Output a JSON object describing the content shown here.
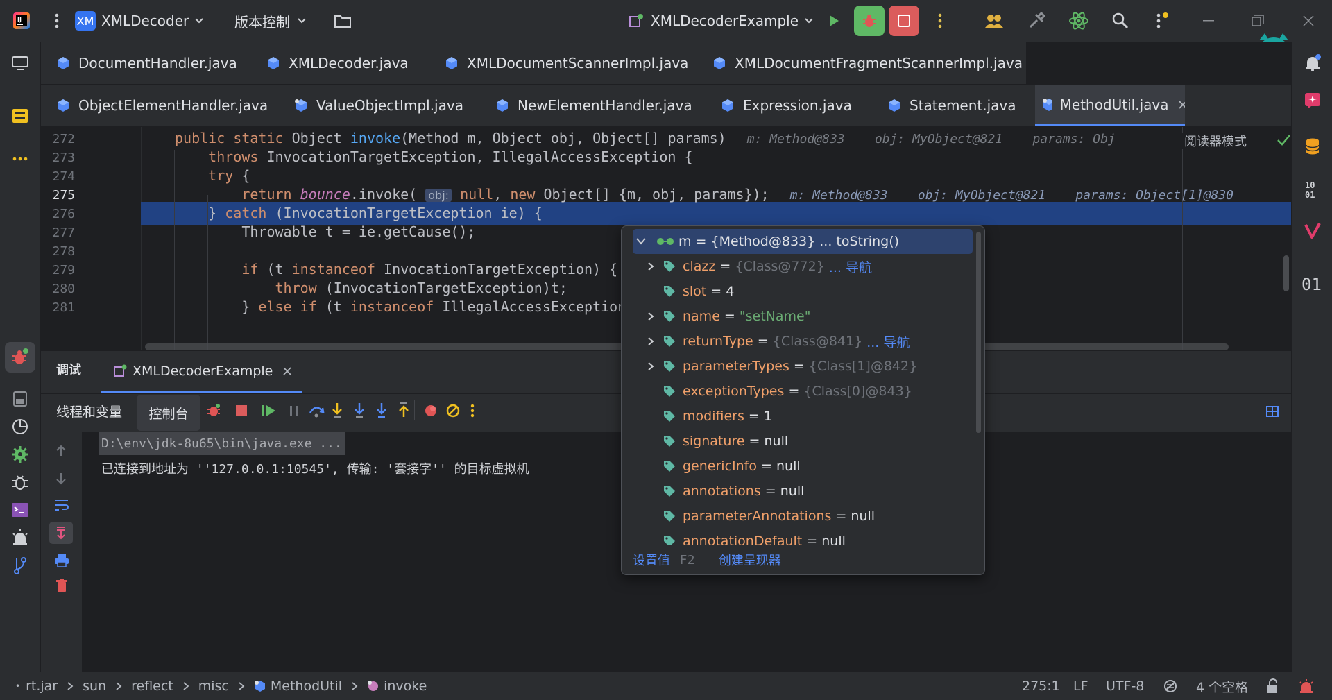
{
  "titlebar": {
    "project_badge": "XM",
    "project_name": "XMLDecoder",
    "vcs_label": "版本控制",
    "run_config": "XMLDecoderExample"
  },
  "editor_tabs": {
    "row1": [
      "DocumentHandler.java",
      "XMLDecoder.java",
      "XMLDocumentScannerImpl.java",
      "XMLDocumentFragmentScannerImpl.java"
    ],
    "row2": [
      "ObjectElementHandler.java",
      "ValueObjectImpl.java",
      "NewElementHandler.java",
      "Expression.java",
      "Statement.java",
      "MethodUtil.java"
    ],
    "active": "MethodUtil.java"
  },
  "editor": {
    "reader_mode": "阅读器模式",
    "lines": [
      {
        "n": "272",
        "segments": [
          [
            "kw",
            "public static "
          ],
          [
            "",
            "Object "
          ],
          [
            "fn",
            "invoke"
          ],
          [
            "",
            "(Method m, Object obj, Object[] params)"
          ]
        ],
        "hint": "m: Method@833    obj: MyObject@821    params: Obj"
      },
      {
        "n": "273",
        "segments": [
          [
            "kw",
            "    throws "
          ],
          [
            "",
            "InvocationTargetException, IllegalAccessException {"
          ]
        ],
        "hint": ""
      },
      {
        "n": "274",
        "segments": [
          [
            "kw",
            "    try "
          ],
          [
            "",
            "{"
          ]
        ],
        "hint": ""
      },
      {
        "n": "275",
        "segments": [
          [
            "kw",
            "        return "
          ],
          [
            "itfn",
            "bounce"
          ],
          [
            "",
            ".invoke( "
          ],
          [
            "inlay",
            "obj:"
          ],
          [
            "kw",
            " null"
          ],
          [
            "",
            ", "
          ],
          [
            "kw",
            "new "
          ],
          [
            "",
            "Object[] {m, obj, params});"
          ]
        ],
        "hint": "m: Method@833    obj: MyObject@821    params: Object[1]@830"
      },
      {
        "n": "276",
        "segments": [
          [
            "",
            "    } "
          ],
          [
            "kw",
            "catch "
          ],
          [
            "",
            "(InvocationTargetException ie) {"
          ]
        ],
        "hint": ""
      },
      {
        "n": "277",
        "segments": [
          [
            "",
            "        Throwable t = ie.getCause();"
          ]
        ],
        "hint": ""
      },
      {
        "n": "278",
        "segments": [
          [
            "",
            ""
          ]
        ],
        "hint": ""
      },
      {
        "n": "279",
        "segments": [
          [
            "kw",
            "        if "
          ],
          [
            "",
            "(t "
          ],
          [
            "kw",
            "instanceof "
          ],
          [
            "",
            "InvocationTargetException) {"
          ]
        ],
        "hint": ""
      },
      {
        "n": "280",
        "segments": [
          [
            "kw",
            "            throw "
          ],
          [
            "",
            "(InvocationTargetException)t;"
          ]
        ],
        "hint": ""
      },
      {
        "n": "281",
        "segments": [
          [
            "",
            "        } "
          ],
          [
            "kw",
            "else if "
          ],
          [
            "",
            "(t "
          ],
          [
            "kw",
            "instanceof "
          ],
          [
            "",
            "IllegalAccessException"
          ]
        ],
        "hint": ""
      }
    ]
  },
  "debug": {
    "tab_debug": "调试",
    "session": "XMLDecoderExample",
    "threads_vars": "线程和变量",
    "console": "控制台",
    "console_lines": [
      "D:\\env\\jdk-8u65\\bin\\java.exe ...",
      "已连接到地址为 ''127.0.0.1:10545', 传输: '套接字'' 的目标虚拟机"
    ]
  },
  "popup": {
    "root": {
      "key": "m",
      "value": "{Method@833} ... toString()"
    },
    "fields": [
      {
        "key": "clazz",
        "eq": " = ",
        "value": "{Class@772}",
        "nav": " ... 导航",
        "kind": "obj",
        "expandable": true
      },
      {
        "key": "slot",
        "eq": " = ",
        "value": "4",
        "nav": "",
        "kind": "prim",
        "expandable": false
      },
      {
        "key": "name",
        "eq": " = ",
        "value": "\"setName\"",
        "nav": "",
        "kind": "str",
        "expandable": true
      },
      {
        "key": "returnType",
        "eq": " = ",
        "value": "{Class@841}",
        "nav": " ... 导航",
        "kind": "obj",
        "expandable": true
      },
      {
        "key": "parameterTypes",
        "eq": " = ",
        "value": "{Class[1]@842}",
        "nav": "",
        "kind": "obj",
        "expandable": true
      },
      {
        "key": "exceptionTypes",
        "eq": " = ",
        "value": "{Class[0]@843}",
        "nav": "",
        "kind": "obj",
        "expandable": false
      },
      {
        "key": "modifiers",
        "eq": " = ",
        "value": "1",
        "nav": "",
        "kind": "prim",
        "expandable": false
      },
      {
        "key": "signature",
        "eq": " = ",
        "value": "null",
        "nav": "",
        "kind": "prim",
        "expandable": false
      },
      {
        "key": "genericInfo",
        "eq": " = ",
        "value": "null",
        "nav": "",
        "kind": "prim",
        "expandable": false
      },
      {
        "key": "annotations",
        "eq": " = ",
        "value": "null",
        "nav": "",
        "kind": "prim",
        "expandable": false
      },
      {
        "key": "parameterAnnotations",
        "eq": " = ",
        "value": "null",
        "nav": "",
        "kind": "prim",
        "expandable": false
      },
      {
        "key": "annotationDefault",
        "eq": " = ",
        "value": "null",
        "nav": "",
        "kind": "prim",
        "expandable": false
      }
    ],
    "set_value": "设置值",
    "set_value_key": "F2",
    "create_renderer": "创建呈现器"
  },
  "statusbar": {
    "breadcrumbs": [
      "rt.jar",
      "sun",
      "reflect",
      "misc",
      "MethodUtil",
      "invoke"
    ],
    "position": "275:1",
    "line_sep": "LF",
    "encoding": "UTF-8",
    "indent": "4 个空格"
  },
  "colors": {
    "accent": "#548af7",
    "selection": "#214283",
    "stop_red": "#db5c5c",
    "debug_green": "#5fb865"
  }
}
